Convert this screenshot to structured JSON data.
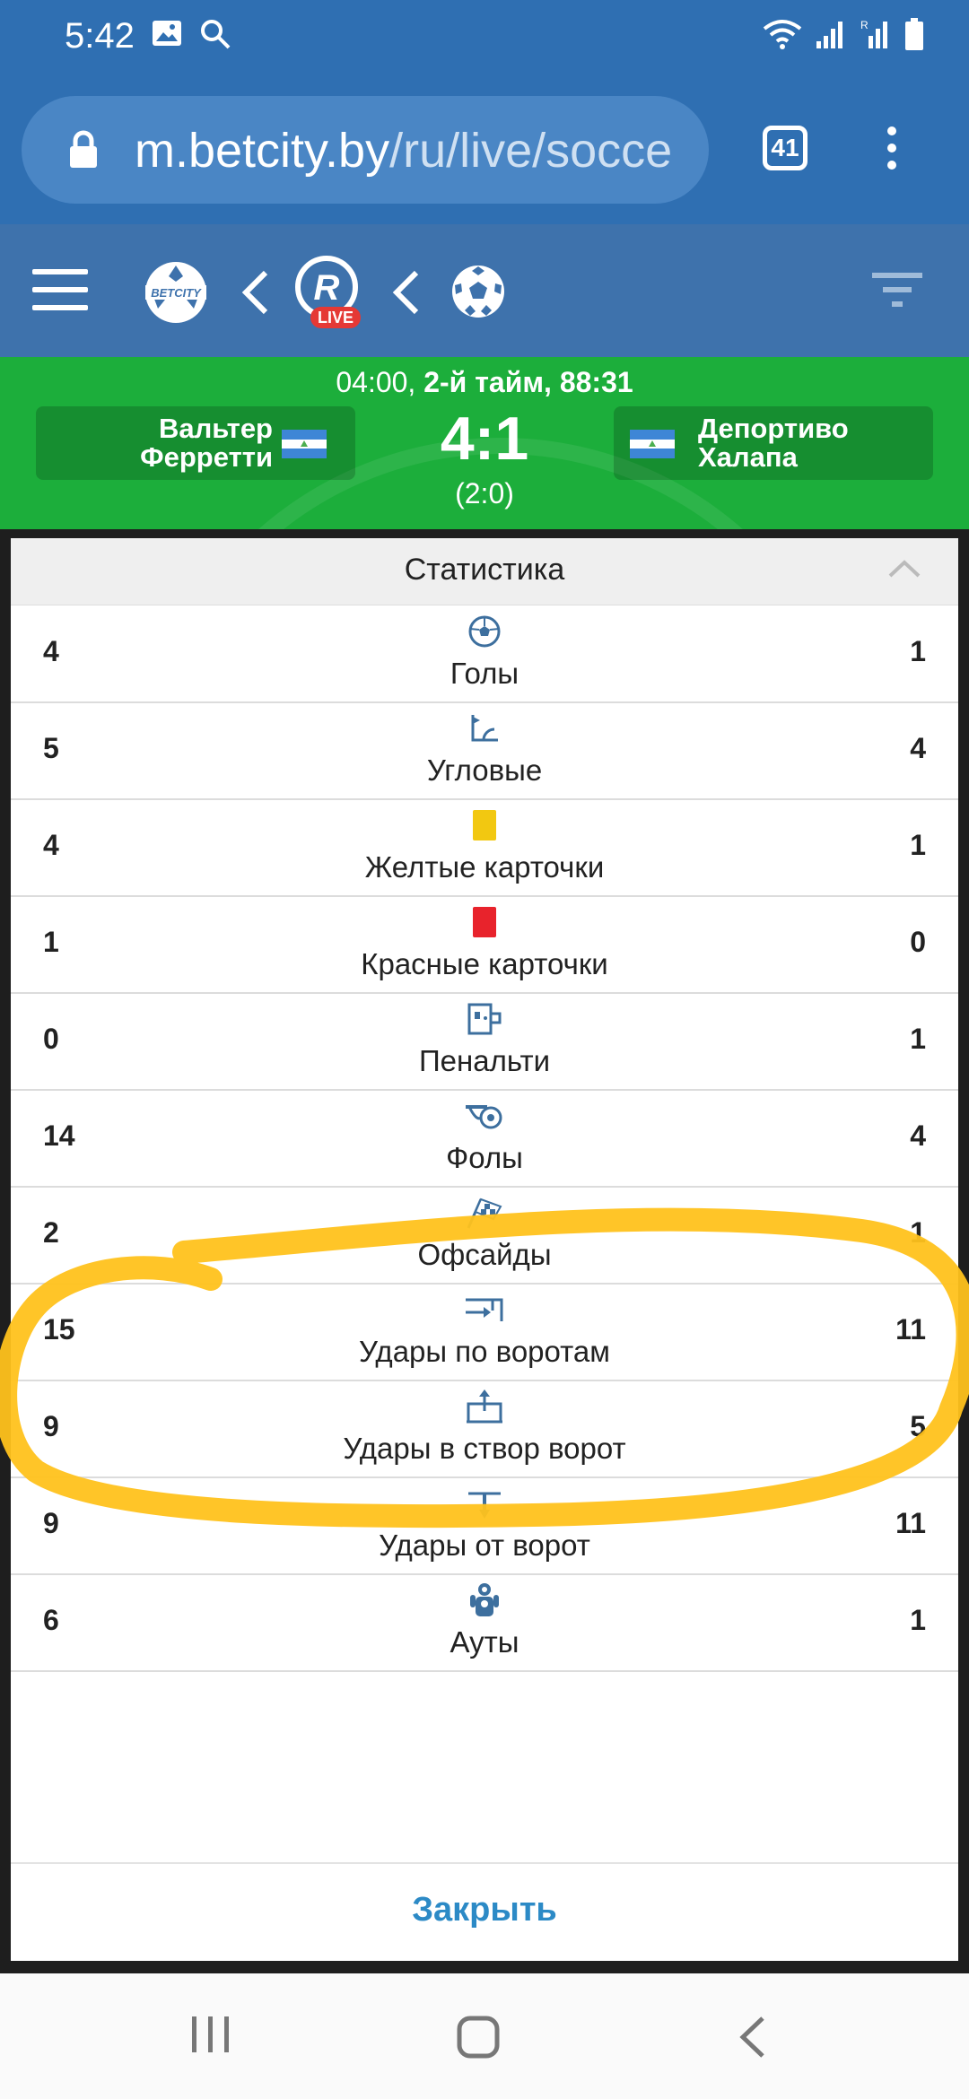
{
  "status_bar": {
    "time": "5:42"
  },
  "browser": {
    "url_host": "m.betcity.by",
    "url_path": "/ru/live/socce",
    "tab_count": "41"
  },
  "site": {
    "logo_text": "BETCITY",
    "live_badge": "LIVE"
  },
  "match": {
    "time_prefix": "04:00, ",
    "time_main": "2-й тайм, 88:31",
    "home_team": "Вальтер\nФерретти",
    "away_team": "Депортиво\nХалапа",
    "score": "4:1",
    "halftime_score": "(2:0)"
  },
  "stats": {
    "title": "Статистика",
    "rows": [
      {
        "label": "Голы",
        "home": "4",
        "away": "1",
        "icon": "soccer-ball-icon"
      },
      {
        "label": "Угловые",
        "home": "5",
        "away": "4",
        "icon": "corner-flag-icon"
      },
      {
        "label": "Желтые карточки",
        "home": "4",
        "away": "1",
        "icon": "yellow-card-icon"
      },
      {
        "label": "Красные карточки",
        "home": "1",
        "away": "0",
        "icon": "red-card-icon"
      },
      {
        "label": "Пенальти",
        "home": "0",
        "away": "1",
        "icon": "penalty-icon"
      },
      {
        "label": "Фолы",
        "home": "14",
        "away": "4",
        "icon": "whistle-icon"
      },
      {
        "label": "Офсайды",
        "home": "2",
        "away": "1",
        "icon": "offside-flag-icon"
      },
      {
        "label": "Удары по воротам",
        "home": "15",
        "away": "11",
        "icon": "shots-icon"
      },
      {
        "label": "Удары в створ ворот",
        "home": "9",
        "away": "5",
        "icon": "shots-on-target-icon"
      },
      {
        "label": "Удары от ворот",
        "home": "9",
        "away": "11",
        "icon": "goal-kick-icon"
      },
      {
        "label": "Ауты",
        "home": "6",
        "away": "1",
        "icon": "throw-in-icon"
      }
    ],
    "close_label": "Закрыть"
  },
  "colors": {
    "browser_bar": "#2f6fb2",
    "site_header": "#3e72ac",
    "match_bar": "#1cae3b",
    "highlight": "#ffc21c",
    "close_text": "#2c8ac6"
  }
}
